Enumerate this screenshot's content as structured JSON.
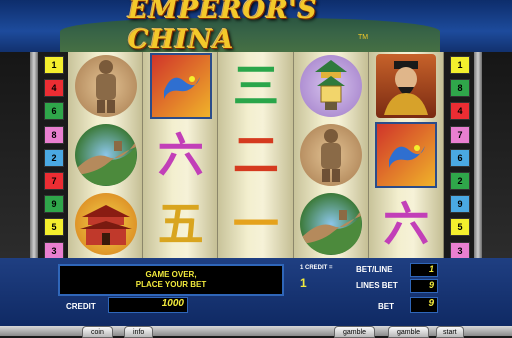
{
  "game": {
    "title": "EMPEROR'S CHINA",
    "trademark": "TM"
  },
  "lines_left": [
    {
      "num": "1",
      "color": "#f4ef2d"
    },
    {
      "num": "4",
      "color": "#ec2d33"
    },
    {
      "num": "6",
      "color": "#2fa64a"
    },
    {
      "num": "8",
      "color": "#e97fd0"
    },
    {
      "num": "2",
      "color": "#4aa9e3"
    },
    {
      "num": "7",
      "color": "#ec2d33"
    },
    {
      "num": "9",
      "color": "#2fa64a"
    },
    {
      "num": "5",
      "color": "#f4ef2d"
    },
    {
      "num": "3",
      "color": "#e97fd0"
    }
  ],
  "lines_right": [
    {
      "num": "1",
      "color": "#f4ef2d"
    },
    {
      "num": "8",
      "color": "#2fa64a"
    },
    {
      "num": "4",
      "color": "#ec2d33"
    },
    {
      "num": "7",
      "color": "#e97fd0"
    },
    {
      "num": "6",
      "color": "#4aa9e3"
    },
    {
      "num": "2",
      "color": "#2fa64a"
    },
    {
      "num": "9",
      "color": "#4aa9e3"
    },
    {
      "num": "5",
      "color": "#f4ef2d"
    },
    {
      "num": "3",
      "color": "#e97fd0"
    }
  ],
  "reels": [
    [
      "terracotta-warrior",
      "great-wall",
      "temple"
    ],
    [
      "dragon-flag",
      "chinese-six",
      "chinese-five"
    ],
    [
      "chinese-three",
      "chinese-two",
      "chinese-one"
    ],
    [
      "pagoda-lantern",
      "terracotta-warrior",
      "great-wall"
    ],
    [
      "emperor",
      "dragon-flag",
      "chinese-six"
    ]
  ],
  "glyphs": {
    "one": "一",
    "two": "二",
    "three": "三",
    "five": "五",
    "six": "六"
  },
  "panel": {
    "message_line1": "GAME OVER,",
    "message_line2": "PLACE YOUR BET",
    "credit_label": "CREDIT",
    "credit_value": "1000",
    "coin_label": "1 CREDIT =",
    "coin_value": "1",
    "bet_line_label": "BET/LINE",
    "bet_line_value": "1",
    "lines_bet_label": "LINES BET",
    "lines_bet_value": "9",
    "bet_label": "BET",
    "bet_value": "9"
  },
  "buttons": {
    "coin": "coin",
    "info": "info",
    "gamble1": "gamble",
    "gamble2": "gamble",
    "start": "start"
  }
}
